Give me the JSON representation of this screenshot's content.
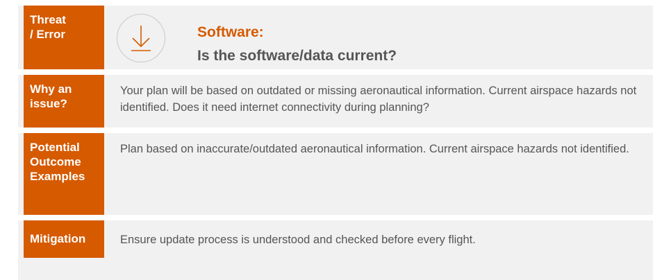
{
  "rows": [
    {
      "label": "Threat\n/ Error"
    },
    {
      "label": "Why an\nissue?",
      "text": "Your plan will be based on outdated or missing aeronautical information. Current airspace hazards not identified. Does it need internet connectivity during planning?"
    },
    {
      "label": "Potential\nOutcome\nExamples",
      "text": "Plan based on inaccurate/outdated aeronautical information. Current airspace hazards not identified."
    },
    {
      "label": "Mitigation",
      "text": "Ensure update process is understood and checked before every flight."
    }
  ],
  "header": {
    "icon": "download-arrow-icon",
    "title_category": "Software:",
    "title_question": "Is the software/data current?"
  },
  "colors": {
    "accent": "#d65a00",
    "panel": "#f1f1f1",
    "text": "#555555"
  }
}
